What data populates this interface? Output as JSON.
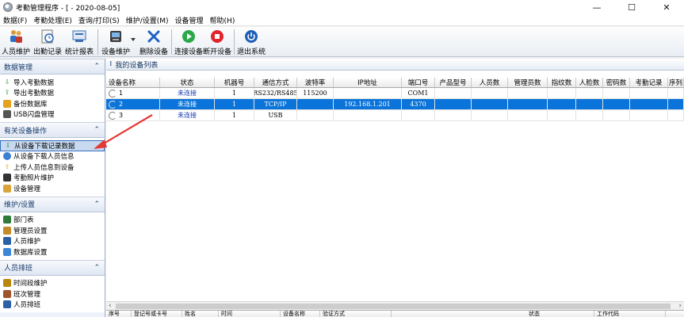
{
  "window": {
    "title": "考勤管理程序 - [ - 2020-08-05]",
    "minimize": "—",
    "maximize": "☐",
    "close": "✕"
  },
  "menu": [
    "数据(F)",
    "考勤处理(E)",
    "查询/打印(S)",
    "维护/设置(M)",
    "设备管理",
    "帮助(H)"
  ],
  "toolbar": {
    "person_maintain": "人员维护",
    "attendance_record": "出勤记录",
    "statistics": "统计报表",
    "device_maintain": "设备维护",
    "delete_device": "删除设备",
    "connect_device": "连接设备",
    "disconnect_device": "断开设备",
    "exit": "退出系统"
  },
  "sidebar": {
    "groups": [
      {
        "title": "数据管理",
        "items": [
          "导入考勤数据",
          "导出考勤数据",
          "备份数据库",
          "USB闪盘管理"
        ]
      },
      {
        "title": "有关设备操作",
        "items": [
          "从设备下载记录数据",
          "从设备下载人员信息",
          "上传人员信息到设备",
          "考勤照片维护",
          "设备管理"
        ]
      },
      {
        "title": "维护/设置",
        "items": [
          "部门表",
          "管理员设置",
          "人员维护",
          "数据库设置"
        ]
      },
      {
        "title": "人员排班",
        "items": [
          "时间段维护",
          "班次管理",
          "人员排班"
        ]
      }
    ],
    "chevron": "⌃"
  },
  "panel": {
    "title": "我的设备列表",
    "grip": "⁞"
  },
  "grid": {
    "columns": [
      "设备名称",
      "状态",
      "机器号",
      "通信方式",
      "波特率",
      "IP地址",
      "端口号",
      "产品型号",
      "人员数",
      "管理员数",
      "指纹数",
      "人脸数",
      "密码数",
      "考勤记录",
      "序列"
    ],
    "rows": [
      {
        "name": "1",
        "status": "未连接",
        "machine": "1",
        "comm": "RS232/RS485",
        "baud": "115200",
        "ip": "",
        "port": "COM1"
      },
      {
        "name": "2",
        "status": "未连接",
        "machine": "1",
        "comm": "TCP/IP",
        "baud": "",
        "ip": "192.168.1.201",
        "port": "4370"
      },
      {
        "name": "3",
        "status": "未连接",
        "machine": "1",
        "comm": "USB",
        "baud": "",
        "ip": "",
        "port": ""
      }
    ]
  },
  "log_columns": [
    "序号",
    "登记号或卡号",
    "姓名",
    "时间",
    "设备名称",
    "验证方式",
    "状态",
    "工作代码"
  ],
  "colors": {
    "selection": "#0a74da",
    "status_text": "#1537b0",
    "annotation": "#e53935"
  }
}
